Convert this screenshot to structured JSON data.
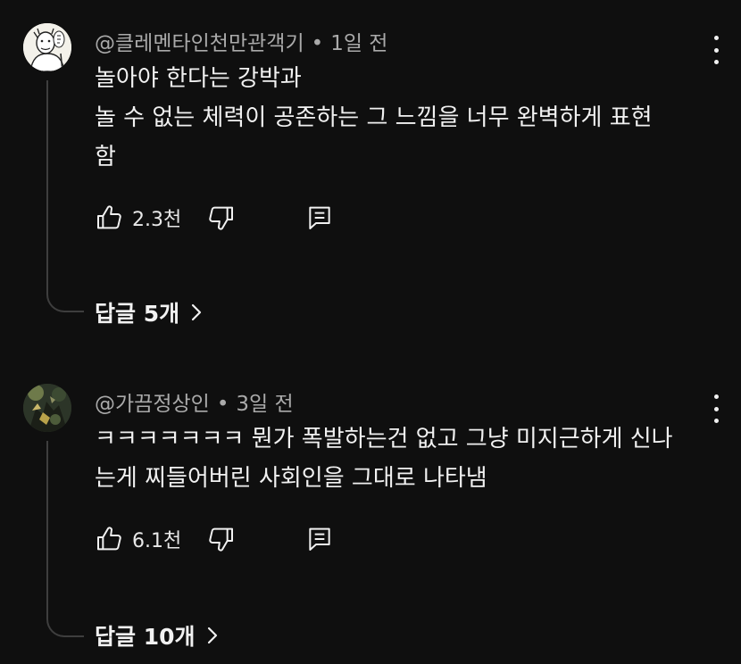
{
  "comments": [
    {
      "author": "@클레멘타인천만관객기",
      "separator": "•",
      "time": "1일 전",
      "lines": [
        "놀아야 한다는 강박과",
        "놀 수 없는 체력이 공존하는 그 느낌을 너무 완벽하게 표현",
        "함"
      ],
      "likes": "2.3천",
      "replies": "답글 5개"
    },
    {
      "author": "@가끔정상인",
      "separator": "•",
      "time": "3일 전",
      "lines": [
        "ㅋㅋㅋㅋㅋㅋㅋ 뭔가 폭발하는건 없고 그냥 미지근하게 신나",
        "는게 찌들어버린 사회인을 그대로 나타냄"
      ],
      "likes": "6.1천",
      "replies": "답글 10개"
    }
  ],
  "icons": {
    "like": "thumbs-up-icon",
    "dislike": "thumbs-down-icon",
    "reply": "comment-reply-icon",
    "more": "more-vert-icon",
    "chevron": "chevron-right-icon"
  },
  "colors": {
    "background": "#0f0f0f",
    "text": "#f1f1f1",
    "secondary": "#aaaaaa",
    "thread": "#3e3e3e"
  }
}
